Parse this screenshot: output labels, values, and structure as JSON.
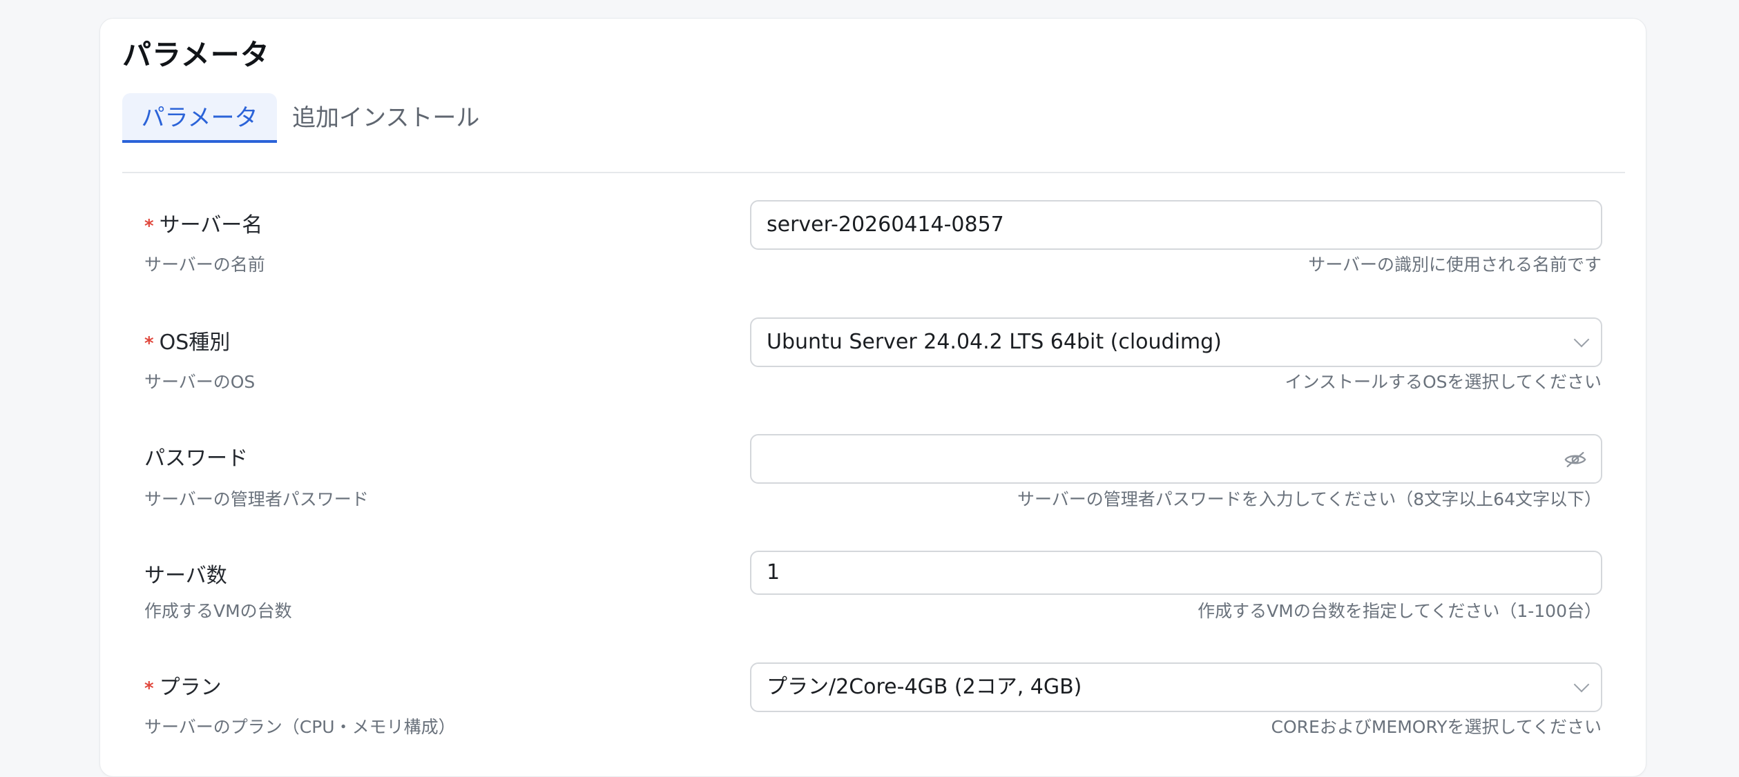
{
  "section": {
    "title": "パラメータ"
  },
  "tabs": [
    {
      "label": "パラメータ",
      "active": true
    },
    {
      "label": "追加インストール",
      "active": false
    }
  ],
  "fields": {
    "server_name": {
      "required_mark": "*",
      "label": "サーバー名",
      "sub": "サーバーの名前",
      "value": "server-20260414-0857",
      "hint": "サーバーの識別に使用される名前です"
    },
    "os_type": {
      "required_mark": "*",
      "label": "OS種別",
      "sub": "サーバーのOS",
      "value": "Ubuntu Server 24.04.2 LTS 64bit (cloudimg)",
      "hint": "インストールするOSを選択してください",
      "icon": "chevron-down-icon"
    },
    "password": {
      "label": "パスワード",
      "sub": "サーバーの管理者パスワード",
      "value": "",
      "hint": "サーバーの管理者パスワードを入力してください（8文字以上64文字以下）",
      "icon": "eye-off-icon"
    },
    "server_count": {
      "label": "サーバ数",
      "sub": "作成するVMの台数",
      "value": "1",
      "hint": "作成するVMの台数を指定してください（1-100台）"
    },
    "plan": {
      "required_mark": "*",
      "label": "プラン",
      "sub": "サーバーのプラン（CPU・メモリ構成）",
      "value": "プラン/2Core-4GB (2コア, 4GB)",
      "hint": "COREおよびMEMORYを選択してください",
      "icon": "chevron-down-icon"
    }
  },
  "colors": {
    "accent": "#2b63d8",
    "required": "#e0483d",
    "background": "#f6f7f9",
    "border": "#d4d7db"
  }
}
